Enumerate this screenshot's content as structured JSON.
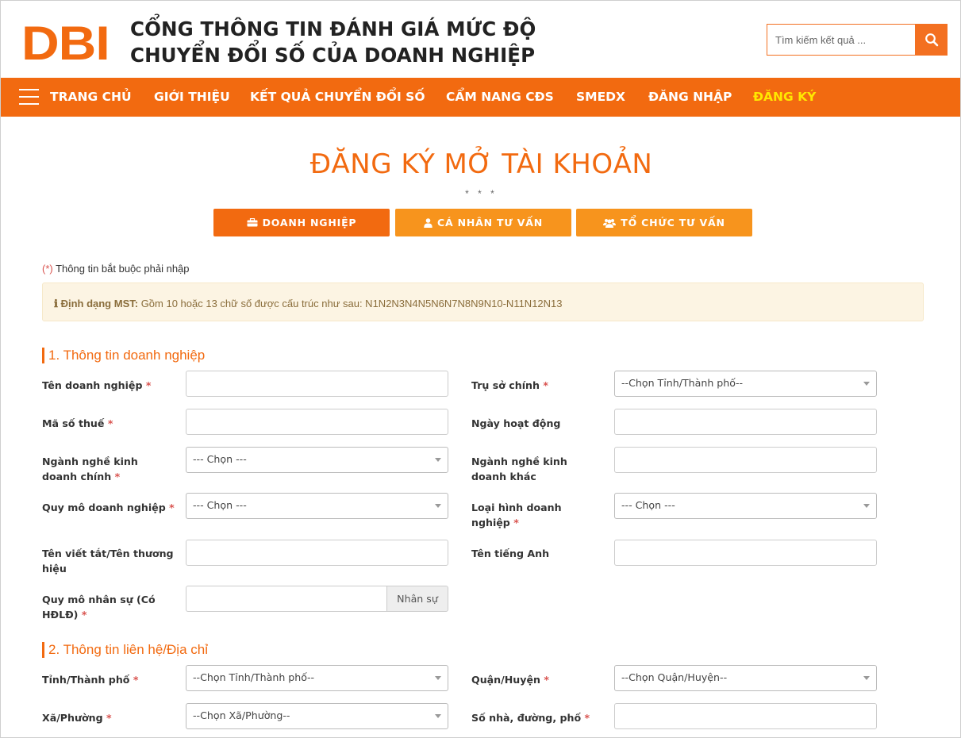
{
  "header": {
    "logo_text": "DBI",
    "title_line1": "CỔNG THÔNG TIN ĐÁNH GIÁ MỨC ĐỘ",
    "title_line2": "CHUYỂN ĐỔI SỐ CỦA DOANH NGHIỆP",
    "search_placeholder": "Tìm kiếm kết quả ...",
    "brand_color": "#f26a10"
  },
  "nav": {
    "items": [
      {
        "label": "TRANG CHỦ"
      },
      {
        "label": "GIỚI THIỆU"
      },
      {
        "label": "KẾT QUẢ CHUYỂN ĐỔI SỐ"
      },
      {
        "label": "CẨM NANG CĐS"
      },
      {
        "label": "SMEDX"
      },
      {
        "label": "ĐĂNG NHẬP"
      },
      {
        "label": "ĐĂNG KÝ",
        "active": true
      }
    ]
  },
  "page": {
    "title": "ĐĂNG KÝ MỞ TÀI KHOẢN",
    "dots": "* * *",
    "tabs": [
      {
        "label": "DOANH NGHIỆP",
        "icon": "briefcase-icon",
        "active": true
      },
      {
        "label": "CÁ NHÂN TƯ VẤN",
        "icon": "user-icon"
      },
      {
        "label": "TỔ CHỨC TƯ VẤN",
        "icon": "users-icon"
      }
    ],
    "required_star": "(*)",
    "required_note": " Thông tin bắt buộc phải nhập",
    "alert_label": "Định dạng MST:",
    "alert_text": " Gồm 10 hoặc 13 chữ số được cấu trúc như sau: N1N2N3N4N5N6N7N8N9N10-N11N12N13"
  },
  "section1": {
    "title": "1. Thông tin doanh nghiệp",
    "ten_dn": "Tên doanh nghiệp",
    "tru_so": "Trụ sở chính",
    "tru_so_value": "--Chọn Tỉnh/Thành phố--",
    "mst": "Mã số thuế",
    "ngay_hd": "Ngày hoạt động",
    "nganh_chinh_1": "Ngành nghề kinh",
    "nganh_chinh_2": "doanh chính",
    "nganh_chinh_value": "--- Chọn ---",
    "nganh_khac_1": "Ngành nghề kinh",
    "nganh_khac_2": "doanh khác",
    "quy_mo": "Quy mô doanh nghiệp",
    "quy_mo_value": "--- Chọn ---",
    "loai_hinh_1": "Loại hình doanh",
    "loai_hinh_2": "nghiệp",
    "loai_hinh_value": "--- Chọn ---",
    "ten_tat_1": "Tên viết tắt/Tên thương",
    "ten_tat_2": "hiệu",
    "ten_anh": "Tên tiếng Anh",
    "nhan_su_1": "Quy mô nhân sự (Có",
    "nhan_su_2": "HĐLĐ)",
    "nhan_su_addon": "Nhân sự",
    "req": "*"
  },
  "section2": {
    "title": "2. Thông tin liên hệ/Địa chỉ",
    "tinh": "Tỉnh/Thành phố",
    "tinh_value": "--Chọn Tỉnh/Thành phố--",
    "quan": "Quận/Huyện",
    "quan_value": "--Chọn Quận/Huyện--",
    "xa": "Xã/Phường",
    "xa_value": "--Chọn Xã/Phường--",
    "so_nha": "Số nhà, đường, phố"
  }
}
